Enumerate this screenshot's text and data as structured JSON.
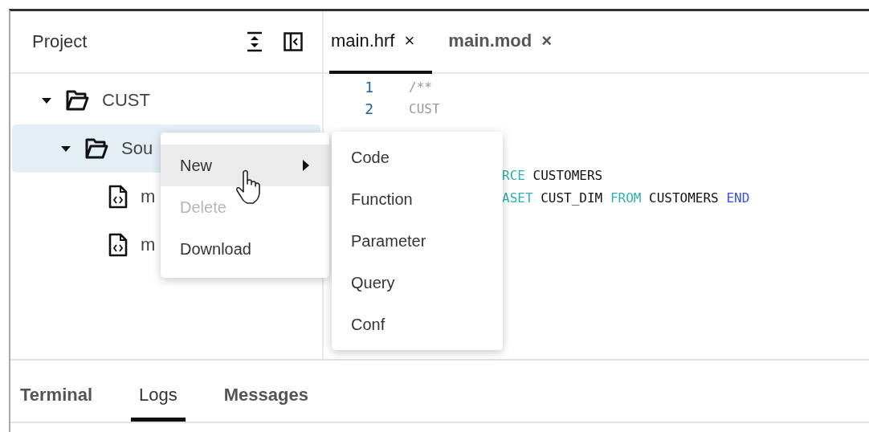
{
  "sidebar": {
    "title": "Project",
    "tree": [
      {
        "label": "CUST",
        "kind": "folder",
        "expanded": true,
        "selected": false,
        "children": [
          {
            "label": "Sou",
            "kind": "folder",
            "expanded": true,
            "selected": true,
            "children": [
              {
                "label": "m",
                "kind": "file",
                "selected": false
              },
              {
                "label": "m",
                "kind": "file",
                "selected": false
              }
            ]
          }
        ]
      }
    ]
  },
  "editor": {
    "tabs": [
      {
        "label": "main.hrf",
        "close": "×",
        "selected": true
      },
      {
        "label": "main.mod",
        "close": "×",
        "selected": false
      }
    ],
    "code_lines": [
      {
        "number": "1",
        "tokens": [
          {
            "text": "/**",
            "kind": "comment"
          }
        ]
      },
      {
        "number": "2",
        "tokens": [
          {
            "text": "CUST",
            "kind": "comment"
          }
        ]
      }
    ],
    "partial_lines": [
      {
        "tokens": [
          {
            "text": "RCE",
            "kind": "keyword"
          },
          {
            "text": "CUSTOMERS",
            "kind": "ident"
          }
        ]
      },
      {
        "tokens": [
          {
            "text": "ASET",
            "kind": "keyword"
          },
          {
            "text": "CUST_DIM",
            "kind": "ident"
          },
          {
            "text": "FROM",
            "kind": "keyword"
          },
          {
            "text": "CUSTOMERS",
            "kind": "ident"
          },
          {
            "text": "END",
            "kind": "end"
          }
        ]
      }
    ]
  },
  "context_menu": {
    "items": [
      {
        "label": "New",
        "selected": true,
        "disabled": false,
        "submenu": true
      },
      {
        "label": "Delete",
        "selected": false,
        "disabled": true,
        "submenu": false
      },
      {
        "label": "Download",
        "selected": false,
        "disabled": false,
        "submenu": false
      }
    ]
  },
  "submenu": {
    "items": [
      {
        "label": "Code"
      },
      {
        "label": "Function"
      },
      {
        "label": "Parameter"
      },
      {
        "label": "Query"
      },
      {
        "label": "Conf"
      }
    ]
  },
  "bottom_panel": {
    "tabs": [
      {
        "label": "Terminal",
        "selected": false
      },
      {
        "label": "Logs",
        "selected": true
      },
      {
        "label": "Messages",
        "selected": false
      }
    ]
  }
}
